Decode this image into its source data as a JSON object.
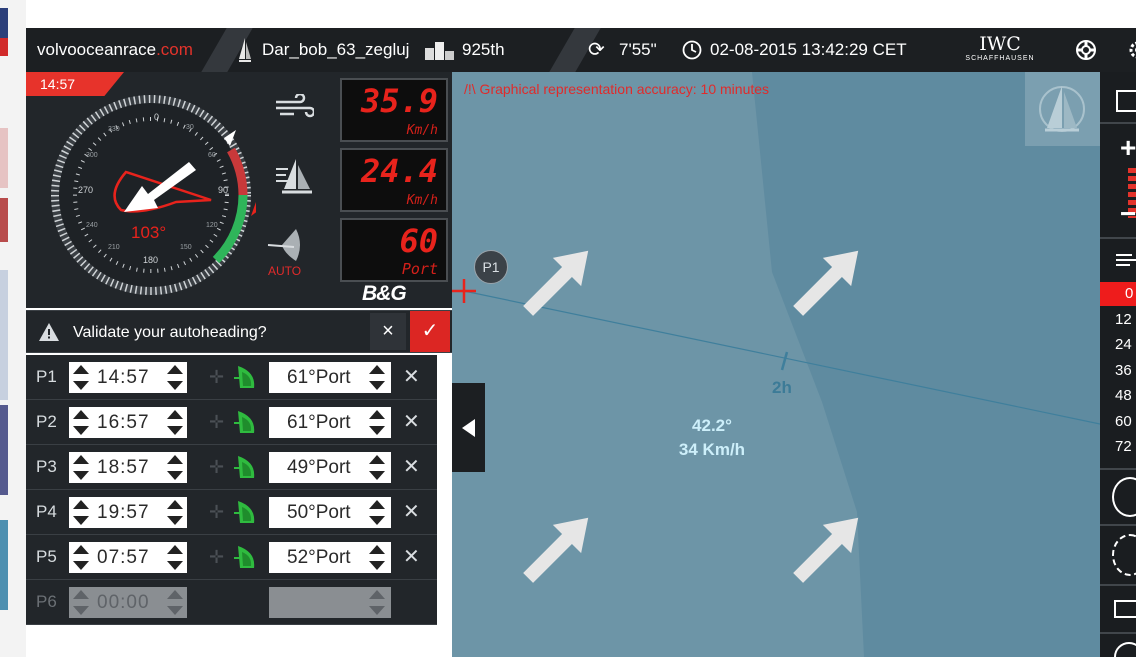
{
  "topbar": {
    "brand_name": "volvooceanrace",
    "brand_tld": ".com",
    "boat_name": "Dar_bob_63_zegluj",
    "ranking": "925th",
    "sync_time": "7'55\"",
    "datetime": "02-08-2015 13:42:29 CET",
    "sponsor": "IWC",
    "sponsor_sub": "SCHAFFHAUSEN"
  },
  "gauge": {
    "timer": "14:57",
    "heading": "103°",
    "auto_label": "AUTO",
    "brand": "B&G",
    "compass_labels": [
      "0",
      "90",
      "180",
      "270",
      "30",
      "60",
      "120",
      "150",
      "210",
      "240",
      "300",
      "330"
    ],
    "wind_speed": "35.9",
    "wind_unit": "Km/h",
    "boat_speed": "24.4",
    "boat_unit": "Km/h",
    "wind_angle": "60",
    "wind_angle_side": "Port"
  },
  "map": {
    "accuracy_note": "/!\\ Graphical representation accuracy: 10 minutes",
    "wind_direction": "42.2°",
    "wind_speed": "34 Km/h",
    "time_marker": "2h",
    "waypoint_label": "P1"
  },
  "validate": {
    "text": "Validate your autoheading?",
    "cancel_icon": "×",
    "confirm_icon": "✓"
  },
  "programs": [
    {
      "id": "P1",
      "time": "14:57",
      "heading": "61°Port"
    },
    {
      "id": "P2",
      "time": "16:57",
      "heading": "61°Port"
    },
    {
      "id": "P3",
      "time": "18:57",
      "heading": "49°Port"
    },
    {
      "id": "P4",
      "time": "19:57",
      "heading": "50°Port"
    },
    {
      "id": "P5",
      "time": "07:57",
      "heading": "52°Port"
    },
    {
      "id": "P6",
      "time": "00:00",
      "heading": ""
    }
  ],
  "rightbar": {
    "zoom_in": "+",
    "zoom_out": "−",
    "time_steps": [
      "0",
      "12",
      "24",
      "36",
      "48",
      "60",
      "72"
    ]
  },
  "colors": {
    "accent_red": "#e3332b",
    "map_sea": "#6d95a7",
    "panel_dark": "#22262a"
  }
}
